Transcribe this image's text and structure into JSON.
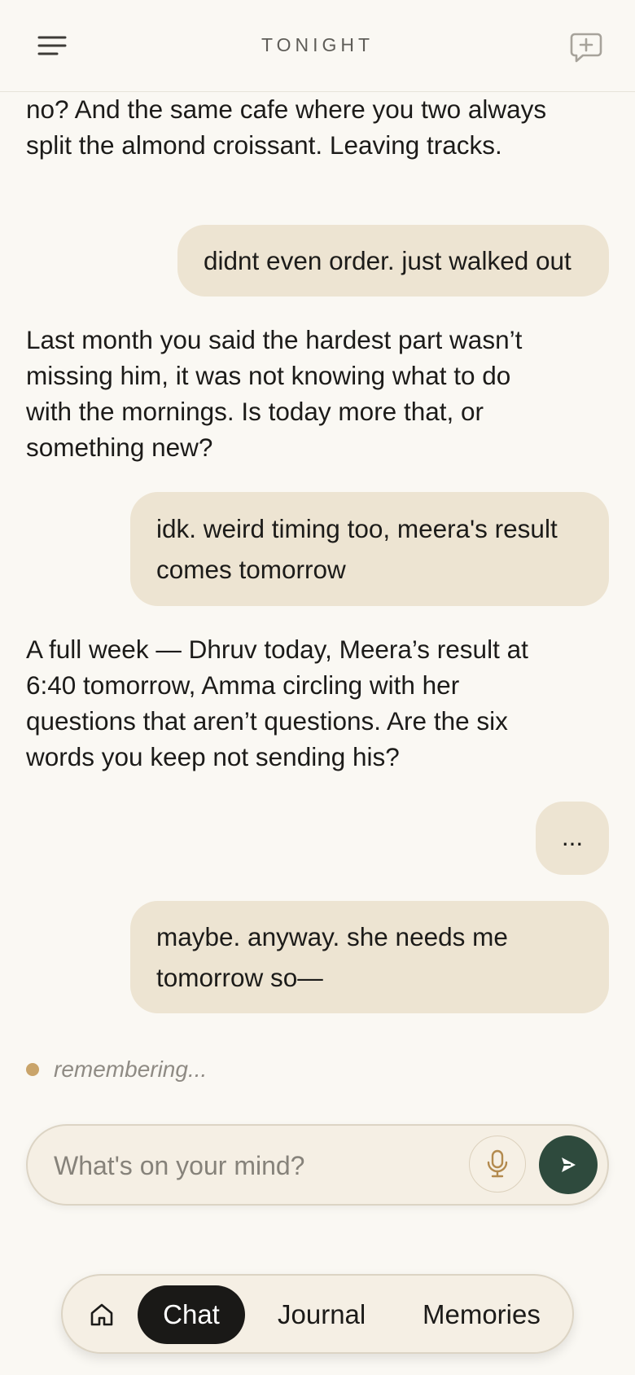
{
  "header": {
    "title": "TONIGHT",
    "menu_icon": "menu-icon",
    "new_chat_icon": "new-chat-icon"
  },
  "messages": [
    {
      "role": "assistant",
      "text": "no? And the same cafe where you two always split the almond croissant. Leaving tracks."
    },
    {
      "role": "user",
      "text": "didnt even order. just walked out"
    },
    {
      "role": "assistant",
      "text": "Last month you said the hardest part wasn’t missing him, it was not knowing what to do with the mornings. Is today more that, or something new?"
    },
    {
      "role": "user",
      "text": "idk. weird timing too, meera's result comes tomorrow"
    },
    {
      "role": "assistant",
      "text": "A full week — Dhruv today, Meera’s result at 6:40 tomorrow, Amma circling with her questions that aren’t questions. Are the six words you keep not sending his?"
    },
    {
      "role": "user",
      "text": "..."
    },
    {
      "role": "user",
      "text": "maybe. anyway. she needs me tomorrow so—"
    }
  ],
  "status": {
    "text": "remembering..."
  },
  "composer": {
    "placeholder": "What's on your mind?",
    "value": "",
    "mic_icon": "microphone-icon",
    "send_icon": "send-icon"
  },
  "nav": {
    "home_icon": "home-icon",
    "items": [
      {
        "label": "Chat",
        "active": true
      },
      {
        "label": "Journal",
        "active": false
      },
      {
        "label": "Memories",
        "active": false
      }
    ]
  },
  "colors": {
    "background": "#faf8f3",
    "user_bubble": "#ede4d2",
    "accent_dot": "#c9a46a",
    "send_button": "#2e4a3d",
    "active_tab": "#1a1917"
  }
}
